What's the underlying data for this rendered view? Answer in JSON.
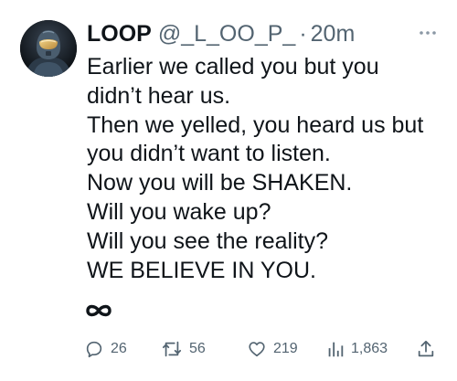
{
  "tweet": {
    "display_name": "LOOP",
    "handle": "@_L_OO_P_",
    "separator": "·",
    "time": "20m",
    "lines": [
      "Earlier we called you but you",
      "didn’t hear us.",
      "Then we yelled, you heard us but",
      "you didn’t want to listen.",
      "Now you will be SHAKEN.",
      "Will you wake up?",
      "Will you see the reality?",
      "WE BELIEVE IN YOU."
    ],
    "emoji": "infinity-icon"
  },
  "actions": {
    "replies": "26",
    "retweets": "56",
    "likes": "219",
    "views": "1,863"
  },
  "colors": {
    "text": "#0f1419",
    "secondary": "#536471"
  }
}
